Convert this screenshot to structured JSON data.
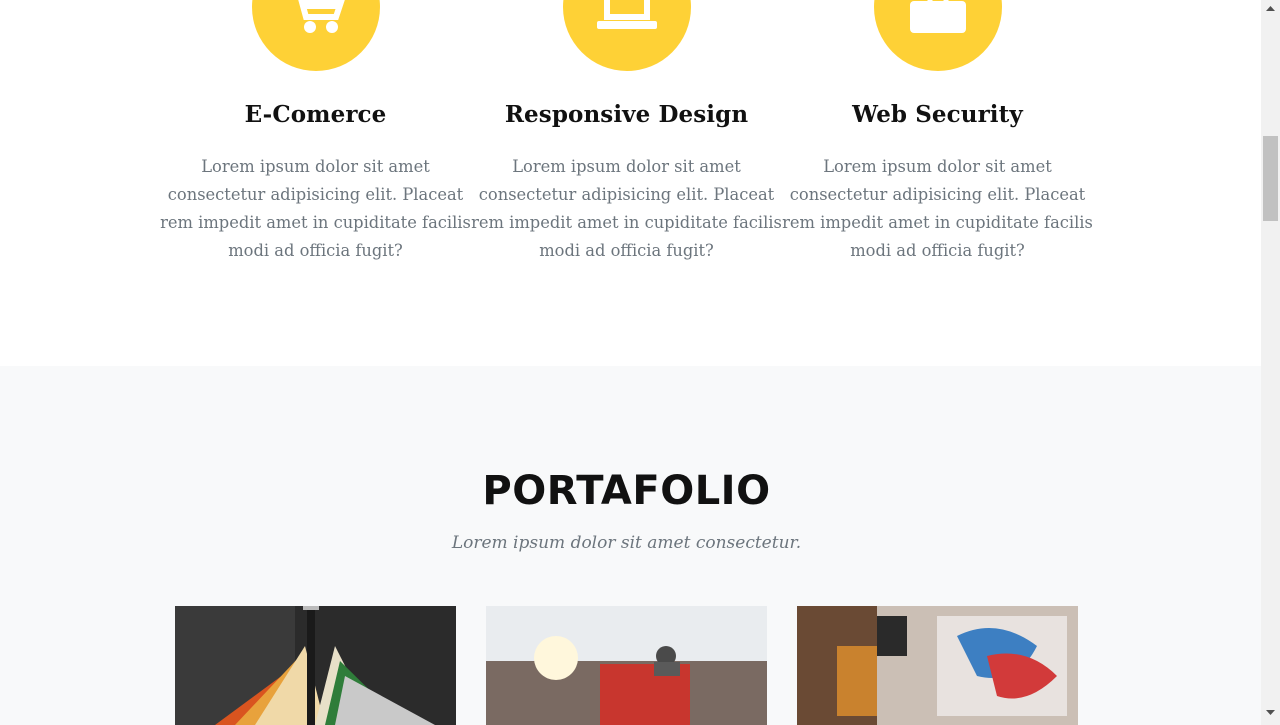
{
  "services": [
    {
      "icon": "shopping-cart-icon",
      "title": "E-Comerce",
      "text": "Lorem ipsum dolor sit amet consectetur adipisicing elit. Placeat rem impedit amet in cupiditate facilis modi ad officia fugit?"
    },
    {
      "icon": "laptop-icon",
      "title": "Responsive Design",
      "text": "Lorem ipsum dolor sit amet consectetur adipisicing elit. Placeat rem impedit amet in cupiditate facilis modi ad officia fugit?"
    },
    {
      "icon": "lock-icon",
      "title": "Web Security",
      "text": "Lorem ipsum dolor sit amet consectetur adipisicing elit. Placeat rem impedit amet in cupiditate facilis modi ad officia fugit?"
    }
  ],
  "portfolio": {
    "heading": "PORTAFOLIO",
    "subheading": "Lorem ipsum dolor sit amet consectetur.",
    "items": [
      {
        "image": "clothes-rack-photo"
      },
      {
        "image": "keep-flag-photo"
      },
      {
        "image": "craft-tools-photo"
      }
    ]
  },
  "colors": {
    "accent": "#fed136",
    "section_bg": "#f8f9fa",
    "muted_text": "#6c757d"
  }
}
